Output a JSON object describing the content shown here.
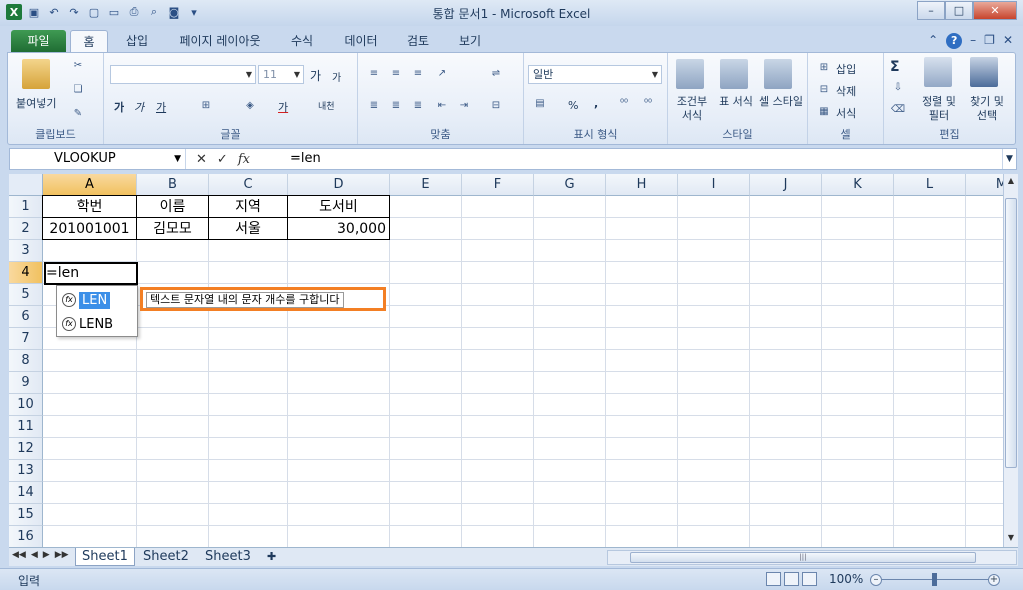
{
  "window": {
    "title": "통합 문서1 - Microsoft Excel",
    "buttons": {
      "minimize": "–",
      "maximize": "□",
      "close": "✕"
    }
  },
  "tabs": [
    "파일",
    "홈",
    "삽입",
    "페이지 레이아웃",
    "수식",
    "데이터",
    "검토",
    "보기"
  ],
  "ribbon": {
    "clipboard": {
      "label": "클립보드",
      "paste": "붙여넣기"
    },
    "font": {
      "label": "글꼴",
      "size": "11",
      "bold": "가",
      "italic": "가",
      "underline": "가",
      "grow": "가",
      "shrink": "가",
      "color": "가",
      "phonetic": "내천"
    },
    "alignment": {
      "label": "맞춤"
    },
    "number": {
      "label": "표시 형식",
      "format": "일반",
      "percent": "%",
      "comma": ","
    },
    "styles": {
      "label": "스타일",
      "conditional": "조건부 서식",
      "table": "표 서식",
      "cell": "셀 스타일"
    },
    "cells": {
      "label": "셀",
      "insert": "삽입",
      "delete": "삭제",
      "format": "서식"
    },
    "editing": {
      "label": "편집",
      "sort": "정렬 및 필터",
      "find": "찾기 및 선택",
      "sum": "Σ"
    }
  },
  "formula_bar": {
    "name_box": "VLOOKUP",
    "cancel": "✕",
    "enter": "✓",
    "fx": "fx",
    "formula": "=len"
  },
  "grid": {
    "columns": [
      "A",
      "B",
      "C",
      "D",
      "E",
      "F",
      "G",
      "H",
      "I",
      "J",
      "K",
      "L",
      "M"
    ],
    "rows": [
      "1",
      "2",
      "3",
      "4",
      "5",
      "6",
      "7",
      "8",
      "9",
      "10",
      "11",
      "12",
      "13",
      "14",
      "15",
      "16"
    ],
    "cells": {
      "A1": "학번",
      "B1": "이름",
      "C1": "지역",
      "D1": "도서비",
      "A2": "201001001",
      "B2": "김모모",
      "C2": "서울",
      "D2": "30,000",
      "A4": "=len"
    },
    "active_cell": "A4"
  },
  "autocomplete": {
    "items": [
      "LEN",
      "LENB"
    ],
    "tooltip": "텍스트 문자열 내의 문자 개수를 구합니다"
  },
  "sheets": [
    "Sheet1",
    "Sheet2",
    "Sheet3"
  ],
  "status": {
    "mode": "입력",
    "zoom": "100%"
  }
}
